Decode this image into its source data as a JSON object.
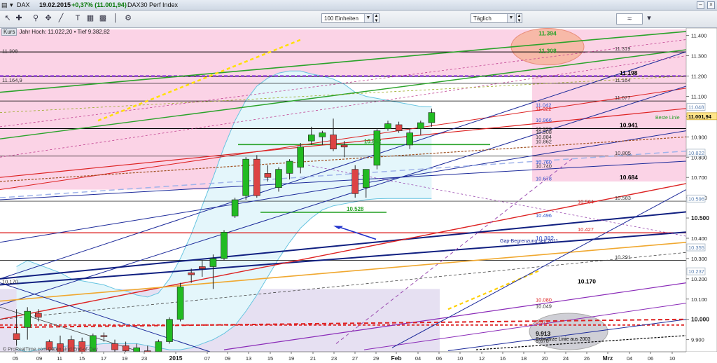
{
  "titlebar": {
    "symbol": "DAX",
    "date": "19.02.2015",
    "change": "+0,37% (11.001,94)",
    "name": "DAX30 Perf Index"
  },
  "toolbar": {
    "units_select": "100 Einheiten",
    "period_select": "Täglich"
  },
  "subbar": {
    "kurs": "Kurs",
    "info": "Jahr Hoch: 11.022,20 • Tief 9.382,82"
  },
  "colors": {
    "bull": "#22bb22",
    "bear": "#dd4444",
    "pink_zone": "#fbd3e6",
    "lavender_zone": "#e6e0f2",
    "bollinger_fill": "#e4f6fb",
    "bollinger_line": "#66c4e0"
  },
  "chart_data": {
    "type": "candlestick",
    "ylim": [
      9840,
      11430
    ],
    "y_ticks": [
      "11.400",
      "11.300",
      "11.200",
      "11.100",
      "11.000",
      "10.900",
      "10.800",
      "10.700",
      "10.600",
      "10.500",
      "10.400",
      "10.300",
      "10.200",
      "10.100",
      "10.000",
      "9.900"
    ],
    "bold_y_ticks": [
      "10.500",
      "10.000"
    ],
    "x_ticks": [
      "05",
      "09",
      "11",
      "15",
      "17",
      "19",
      "23",
      "2015",
      "07",
      "09",
      "13",
      "15",
      "19",
      "21",
      "23",
      "27",
      "29",
      "Feb",
      "04",
      "06",
      "10",
      "12",
      "16",
      "18",
      "20",
      "24",
      "26",
      "Mrz",
      "04",
      "06",
      "10"
    ],
    "candles": [
      {
        "o": 9930,
        "h": 10050,
        "l": 9870,
        "c": 9900
      },
      {
        "o": 9960,
        "h": 10060,
        "l": 9900,
        "c": 10040
      },
      {
        "o": 10030,
        "h": 10050,
        "l": 9990,
        "c": 10010
      },
      {
        "o": 9890,
        "h": 9900,
        "l": 9830,
        "c": 9850
      },
      {
        "o": 9880,
        "h": 9920,
        "l": 9820,
        "c": 9840
      },
      {
        "o": 9900,
        "h": 9920,
        "l": 9820,
        "c": 9840
      },
      {
        "o": 9890,
        "h": 9910,
        "l": 9810,
        "c": 9830
      },
      {
        "o": 9840,
        "h": 9930,
        "l": 9830,
        "c": 9920
      },
      {
        "o": 9920,
        "h": 9935,
        "l": 9890,
        "c": 9915
      },
      {
        "o": 9880,
        "h": 9900,
        "l": 9820,
        "c": 9850
      },
      {
        "o": 9870,
        "h": 9890,
        "l": 9830,
        "c": 9845
      },
      {
        "o": 9840,
        "h": 9880,
        "l": 9820,
        "c": 9860
      },
      {
        "o": 9845,
        "h": 9870,
        "l": 9825,
        "c": 9840
      },
      {
        "o": 9840,
        "h": 9900,
        "l": 9830,
        "c": 9890
      },
      {
        "o": 9890,
        "h": 10010,
        "l": 9880,
        "c": 10000
      },
      {
        "o": 10000,
        "h": 10180,
        "l": 9990,
        "c": 10160
      },
      {
        "o": 10230,
        "h": 10250,
        "l": 10180,
        "c": 10220
      },
      {
        "o": 10260,
        "h": 10290,
        "l": 10210,
        "c": 10250
      },
      {
        "o": 10260,
        "h": 10320,
        "l": 10150,
        "c": 10300
      },
      {
        "o": 10300,
        "h": 10440,
        "l": 10290,
        "c": 10430
      },
      {
        "o": 10510,
        "h": 10600,
        "l": 10500,
        "c": 10590
      },
      {
        "o": 10610,
        "h": 10800,
        "l": 10590,
        "c": 10790
      },
      {
        "o": 10790,
        "h": 10810,
        "l": 10600,
        "c": 10610
      },
      {
        "o": 10720,
        "h": 10760,
        "l": 10680,
        "c": 10700
      },
      {
        "o": 10650,
        "h": 10750,
        "l": 10630,
        "c": 10740
      },
      {
        "o": 10720,
        "h": 10790,
        "l": 10690,
        "c": 10780
      },
      {
        "o": 10750,
        "h": 10870,
        "l": 10720,
        "c": 10850
      },
      {
        "o": 10880,
        "h": 10950,
        "l": 10860,
        "c": 10910
      },
      {
        "o": 10900,
        "h": 10930,
        "l": 10860,
        "c": 10920
      },
      {
        "o": 10910,
        "h": 10990,
        "l": 10830,
        "c": 10840
      },
      {
        "o": 10860,
        "h": 10880,
        "l": 10800,
        "c": 10850
      },
      {
        "o": 10740,
        "h": 10760,
        "l": 10600,
        "c": 10620
      },
      {
        "o": 10650,
        "h": 10740,
        "l": 10600,
        "c": 10740
      },
      {
        "o": 10760,
        "h": 10940,
        "l": 10740,
        "c": 10930
      },
      {
        "o": 10940,
        "h": 10980,
        "l": 10930,
        "c": 10965
      },
      {
        "o": 10960,
        "h": 10975,
        "l": 10920,
        "c": 10930
      },
      {
        "o": 10860,
        "h": 10940,
        "l": 10840,
        "c": 10920
      },
      {
        "o": 10940,
        "h": 10980,
        "l": 10910,
        "c": 10970
      },
      {
        "o": 10970,
        "h": 11040,
        "l": 10950,
        "c": 11020
      }
    ],
    "level_labels": [
      {
        "text": "11.308",
        "value": 11308,
        "pos": "left"
      },
      {
        "text": "11.164,9",
        "value": 11164,
        "pos": "left"
      },
      {
        "text": "10.170",
        "value": 10170,
        "pos": "left"
      },
      {
        "text": "11.394",
        "value": 11394,
        "pos": "center"
      },
      {
        "text": "11.308",
        "value": 11308,
        "pos": "center"
      },
      {
        "text": "11.319",
        "value": 11319,
        "pos": "right"
      },
      {
        "text": "11.198",
        "value": 11198,
        "pos": "right"
      },
      {
        "text": "11.164",
        "value": 11164,
        "pos": "right"
      },
      {
        "text": "11.077",
        "value": 11077,
        "pos": "right"
      },
      {
        "text": "11.042",
        "value": 11042,
        "pos": "right"
      },
      {
        "text": "11.022",
        "value": 11022,
        "pos": "right"
      },
      {
        "text": "10.966",
        "value": 10966,
        "pos": "right"
      },
      {
        "text": "10.941",
        "value": 10941,
        "pos": "right"
      },
      {
        "text": "10.923",
        "value": 10923,
        "pos": "right"
      },
      {
        "text": "10.908",
        "value": 10908,
        "pos": "right"
      },
      {
        "text": "10.884",
        "value": 10884,
        "pos": "right"
      },
      {
        "text": "10.862",
        "value": 10862,
        "pos": "right"
      },
      {
        "text": "10.862",
        "value": 10862,
        "pos": "mid"
      },
      {
        "text": "10.805",
        "value": 10805,
        "pos": "right"
      },
      {
        "text": "10.760",
        "value": 10760,
        "pos": "right"
      },
      {
        "text": "10.740",
        "value": 10740,
        "pos": "right"
      },
      {
        "text": "10.684",
        "value": 10684,
        "pos": "right"
      },
      {
        "text": "10.678",
        "value": 10678,
        "pos": "right"
      },
      {
        "text": "10.583",
        "value": 10583,
        "pos": "right"
      },
      {
        "text": "10.528",
        "value": 10528,
        "pos": "mid"
      },
      {
        "text": "10.564",
        "value": 10564,
        "pos": "right"
      },
      {
        "text": "10.496",
        "value": 10496,
        "pos": "right"
      },
      {
        "text": "10.427",
        "value": 10427,
        "pos": "right"
      },
      {
        "text": "10.382",
        "value": 10382,
        "pos": "right"
      },
      {
        "text": "10.291",
        "value": 10291,
        "pos": "right"
      },
      {
        "text": "10.170",
        "value": 10170,
        "pos": "right"
      },
      {
        "text": "10.080",
        "value": 10080,
        "pos": "right"
      },
      {
        "text": "10.049",
        "value": 10049,
        "pos": "right"
      },
      {
        "text": "9.972",
        "value": 9972,
        "pos": "right"
      },
      {
        "text": "9.913",
        "value": 9913,
        "pos": "right"
      },
      {
        "text": "9.878",
        "value": 9878,
        "pos": "right"
      }
    ],
    "right_axis_boxes": [
      {
        "text": "11.048",
        "value": 11048
      },
      {
        "text": "11.001,94",
        "value": 11001.94
      },
      {
        "text": "10.822",
        "value": 10822
      },
      {
        "text": "10.596",
        "value": 10596
      },
      {
        "text": "10.355",
        "value": 10355
      },
      {
        "text": "10.237",
        "value": 10237
      }
    ],
    "annotations": [
      {
        "text": "Beste Linie",
        "value": 10987
      },
      {
        "text": "Gap-Begrenzung seit 2011",
        "value": 10380
      },
      {
        "text": "Schwarze Linie aus 2003",
        "value": 9895
      },
      {
        "text": "© ProRealTime.com Daten sind End-of-Day",
        "value": 9845
      }
    ]
  }
}
